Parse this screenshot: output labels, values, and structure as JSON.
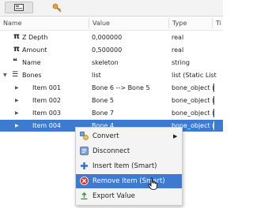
{
  "toolbar": {
    "tabs": [
      {
        "icon": "panel-icon",
        "active": true
      },
      {
        "icon": "key-icon",
        "active": false
      }
    ]
  },
  "columns": {
    "name": "Name",
    "value": "Value",
    "type": "Type",
    "extra": "Ti"
  },
  "rows": [
    {
      "icon": "pi-icon",
      "icon_text": "π",
      "name": "Z Depth",
      "value": "0,000000",
      "type": "real"
    },
    {
      "icon": "pi-icon",
      "icon_text": "π",
      "name": "Amount",
      "value": "0,500000",
      "type": "real"
    },
    {
      "icon": "quote-icon",
      "icon_text": "❝",
      "name": "Name",
      "value": "skeleton",
      "type": "string"
    },
    {
      "icon": "list-icon",
      "icon_text": "☰",
      "name": "Bones",
      "value": "list",
      "type": "list (Static List"
    },
    {
      "name": "Item 001",
      "value": "Bone 6 --> Bone 5",
      "type": "bone_object ("
    },
    {
      "name": "Item 002",
      "value": "Bone 5",
      "type": "bone_object ("
    },
    {
      "name": "Item 003",
      "value": "Bone 7",
      "type": "bone_object ("
    },
    {
      "name": "Item 004",
      "value": "Bone 4",
      "type": "bone_object (",
      "selected": true
    }
  ],
  "context_menu": {
    "items": [
      {
        "label": "Convert",
        "icon": "convert-icon",
        "has_submenu": true
      },
      {
        "label": "Disconnect",
        "icon": "disconnect-icon"
      },
      {
        "label": "Insert Item (Smart)",
        "icon": "insert-plus-icon"
      },
      {
        "label": "Remove Item (Smart)",
        "icon": "remove-icon",
        "highlighted": true
      },
      {
        "label": "Export Value",
        "icon": "export-icon"
      }
    ]
  },
  "colors": {
    "selection": "#3d7bd3",
    "remove_icon": "#d9322b",
    "insert_icon": "#2f6fd0"
  }
}
